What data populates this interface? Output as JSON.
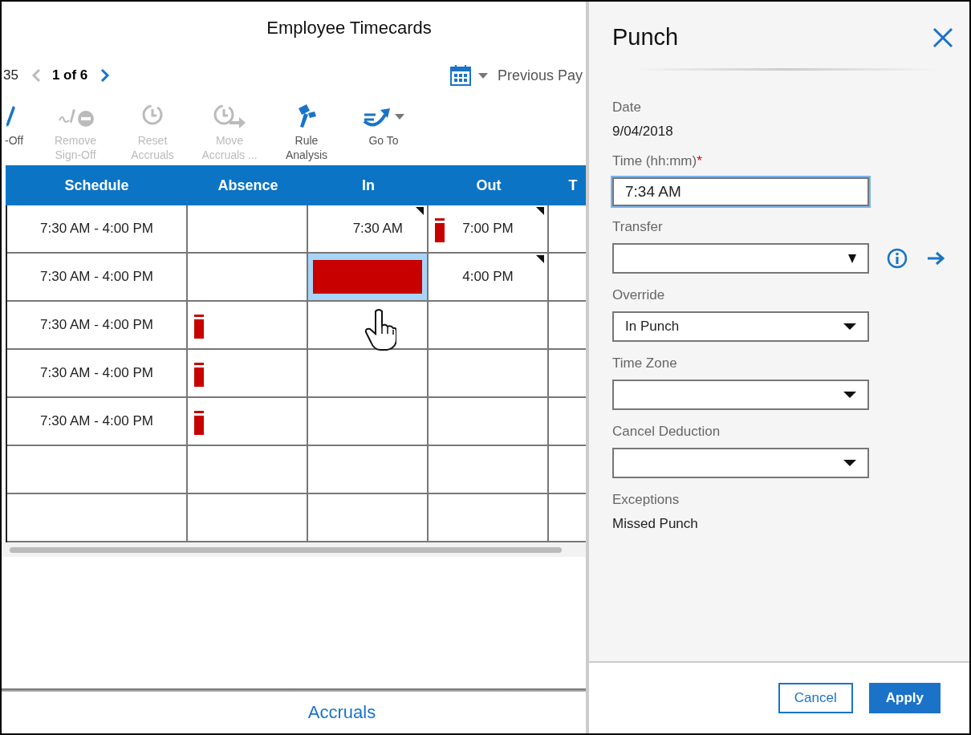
{
  "title": "Employee Timecards",
  "pager": {
    "cut_text": "35",
    "position": "1 of 6"
  },
  "timeframe": {
    "label": "Previous Pay"
  },
  "toolbar": [
    {
      "label": "-Off",
      "disabled": false,
      "dropdown": false
    },
    {
      "label": "Remove Sign-Off",
      "disabled": true,
      "dropdown": false
    },
    {
      "label": "Reset Accruals",
      "disabled": true,
      "dropdown": false
    },
    {
      "label": "Move Accruals ...",
      "disabled": true,
      "dropdown": false
    },
    {
      "label": "Rule Analysis",
      "disabled": false,
      "dropdown": false
    },
    {
      "label": "Go To",
      "disabled": false,
      "dropdown": true
    }
  ],
  "table": {
    "columns": [
      "Schedule",
      "Absence",
      "In",
      "Out",
      "T"
    ],
    "rows": [
      {
        "cells": [
          {
            "text": "7:30 AM - 4:00 PM",
            "flag": false,
            "edited": false,
            "missing": false,
            "selected": false
          },
          {
            "flag": false,
            "edited": false,
            "missing": false,
            "selected": false
          },
          {
            "text": "7:30 AM",
            "flag": false,
            "edited": true,
            "missing": false,
            "selected": false
          },
          {
            "text": "7:00 PM",
            "flag": true,
            "edited": true,
            "missing": false,
            "selected": false
          },
          {
            "flag": false,
            "edited": false,
            "missing": false,
            "selected": false
          }
        ]
      },
      {
        "cells": [
          {
            "text": "7:30 AM - 4:00 PM",
            "flag": false,
            "edited": false,
            "missing": false,
            "selected": false
          },
          {
            "flag": false,
            "edited": false,
            "missing": false,
            "selected": false
          },
          {
            "flag": false,
            "edited": false,
            "missing": true,
            "selected": true
          },
          {
            "text": "4:00 PM",
            "flag": false,
            "edited": true,
            "missing": false,
            "selected": false
          },
          {
            "flag": false,
            "edited": false,
            "missing": false,
            "selected": false
          }
        ]
      },
      {
        "cells": [
          {
            "text": "7:30 AM - 4:00 PM",
            "flag": false,
            "edited": false,
            "missing": false,
            "selected": false
          },
          {
            "flag": true,
            "edited": false,
            "missing": false,
            "selected": false
          },
          {
            "flag": false,
            "edited": false,
            "missing": false,
            "selected": false
          },
          {
            "flag": false,
            "edited": false,
            "missing": false,
            "selected": false
          },
          {
            "flag": false,
            "edited": false,
            "missing": false,
            "selected": false
          }
        ]
      },
      {
        "cells": [
          {
            "text": "7:30 AM - 4:00 PM",
            "flag": false,
            "edited": false,
            "missing": false,
            "selected": false
          },
          {
            "flag": true,
            "edited": false,
            "missing": false,
            "selected": false
          },
          {
            "flag": false,
            "edited": false,
            "missing": false,
            "selected": false
          },
          {
            "flag": false,
            "edited": false,
            "missing": false,
            "selected": false
          },
          {
            "flag": false,
            "edited": false,
            "missing": false,
            "selected": false
          }
        ]
      },
      {
        "cells": [
          {
            "text": "7:30 AM - 4:00 PM",
            "flag": false,
            "edited": false,
            "missing": false,
            "selected": false
          },
          {
            "flag": true,
            "edited": false,
            "missing": false,
            "selected": false
          },
          {
            "flag": false,
            "edited": false,
            "missing": false,
            "selected": false
          },
          {
            "flag": false,
            "edited": false,
            "missing": false,
            "selected": false
          },
          {
            "flag": false,
            "edited": false,
            "missing": false,
            "selected": false
          }
        ]
      },
      {
        "cells": [
          {
            "flag": false,
            "edited": false,
            "missing": false,
            "selected": false
          },
          {
            "flag": false,
            "edited": false,
            "missing": false,
            "selected": false
          },
          {
            "flag": false,
            "edited": false,
            "missing": false,
            "selected": false
          },
          {
            "flag": false,
            "edited": false,
            "missing": false,
            "selected": false
          },
          {
            "flag": false,
            "edited": false,
            "missing": false,
            "selected": false
          }
        ]
      },
      {
        "cells": [
          {
            "flag": false,
            "edited": false,
            "missing": false,
            "selected": false
          },
          {
            "flag": false,
            "edited": false,
            "missing": false,
            "selected": false
          },
          {
            "flag": false,
            "edited": false,
            "missing": false,
            "selected": false
          },
          {
            "flag": false,
            "edited": false,
            "missing": false,
            "selected": false
          },
          {
            "flag": false,
            "edited": false,
            "missing": false,
            "selected": false
          }
        ]
      }
    ]
  },
  "bottom_tab": "Accruals",
  "panel": {
    "title": "Punch",
    "fields": [
      {
        "kind": "text",
        "label": "Date",
        "value": "9/04/2018"
      },
      {
        "kind": "input",
        "label": "Time (hh:mm)",
        "required_mark": "*",
        "value": "7:34 AM",
        "focused": true
      },
      {
        "kind": "native-select",
        "label": "Transfer",
        "actions": true
      },
      {
        "kind": "select",
        "label": "Override",
        "value": "In Punch"
      },
      {
        "kind": "select",
        "label": "Time Zone"
      },
      {
        "kind": "select",
        "label": "Cancel Deduction"
      },
      {
        "kind": "text",
        "label": "Exceptions",
        "value": "Missed Punch"
      }
    ],
    "buttons": [
      {
        "label": "Cancel",
        "primary": false
      },
      {
        "label": "Apply",
        "primary": true
      }
    ]
  }
}
